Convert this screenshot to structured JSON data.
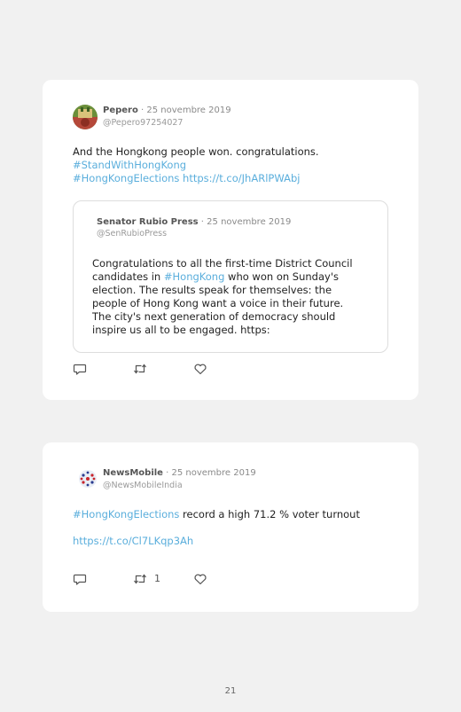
{
  "tweets": [
    {
      "name": "Pepero",
      "date": " · 25 novembre 2019",
      "handle": "@Pepero97254027",
      "text": {
        "plain": "And the Hongkong people won. congratulations.",
        "tag1": "#StandWithHongKong",
        "tag2": "#HongKongElections",
        "link": "https://t.co/JhARlPWAbj"
      },
      "quote": {
        "name": "Senator Rubio Press",
        "date": " · 25 novembre 2019",
        "handle": "@SenRubioPress",
        "text_before": "Congratulations to all the first-time District Council candidates in ",
        "tag": "#HongKong",
        "text_after": " who won on Sunday's election. The results speak for themselves: the people of Hong Kong want a voice in their future. The city's next generation of democracy should inspire us all to be engaged. https:"
      },
      "retweet_count": ""
    },
    {
      "name": "NewsMobile",
      "date": " · 25 novembre 2019",
      "handle": "@NewsMobileIndia",
      "text": {
        "tag": "#HongKongElections",
        "plain": " record a high 71.2 % voter turnout",
        "link": "https://t.co/Cl7LKqp3Ah"
      },
      "retweet_count": "1"
    }
  ],
  "icons": {
    "reply": "reply-icon",
    "retweet": "retweet-icon",
    "like": "heart-icon"
  },
  "colors": {
    "link": "#5aaedc",
    "card": "#ffffff",
    "page": "#f1f1f1"
  },
  "page_number": "21"
}
